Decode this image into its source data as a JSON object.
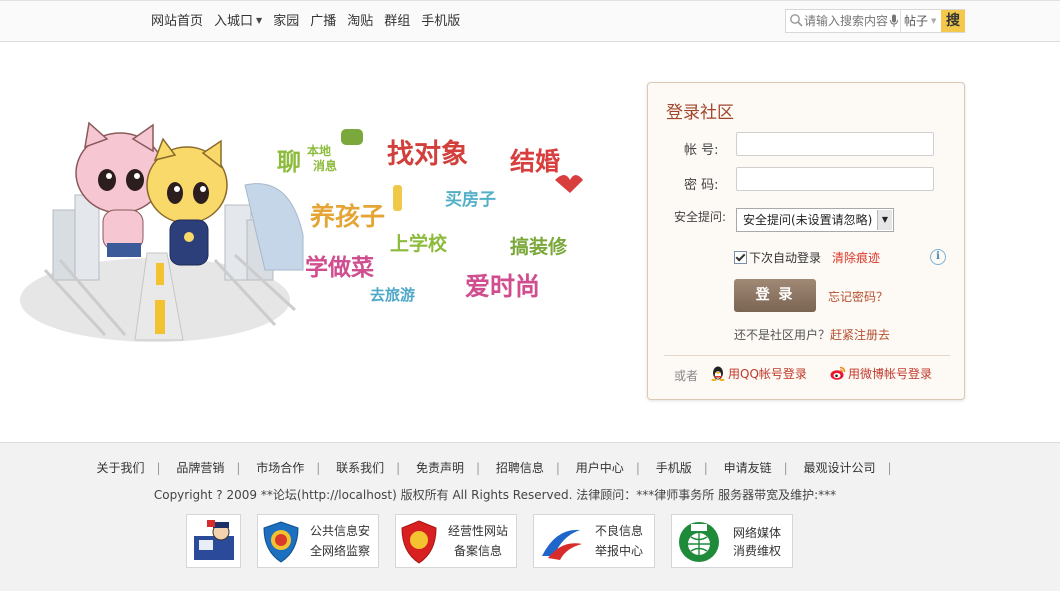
{
  "nav": {
    "items": [
      "网站首页",
      "入城口",
      "家园",
      "广播",
      "淘贴",
      "群组",
      "手机版"
    ]
  },
  "search": {
    "placeholder": "请输入搜索内容",
    "scope": "帖子",
    "button": "搜"
  },
  "illustration": {
    "words": [
      "聊",
      "本地",
      "消息",
      "找对象",
      "结婚",
      "养孩子",
      "买房子",
      "学做菜",
      "上学校",
      "搞装修",
      "去旅游",
      "爱时尚"
    ]
  },
  "login": {
    "title": "登录社区",
    "account_label": "帐   号:",
    "password_label": "密   码:",
    "question_label": "安全提问:",
    "question_value": "安全提问(未设置请忽略)",
    "remember": "下次自动登录",
    "clear": "清除痕迹",
    "submit": "登 录",
    "forgot": "忘记密码？",
    "not_member": "还不是社区用户？",
    "register": "赶紧注册去",
    "or": "或者",
    "qq": "用QQ帐号登录",
    "weibo": "用微博帐号登录"
  },
  "footer": {
    "links": [
      "关于我们",
      "品牌营销",
      "市场合作",
      "联系我们",
      "免责声明",
      "招聘信息",
      "用户中心",
      "手机版",
      "申请友链",
      "最观设计公司"
    ],
    "copyright": "Copyright ? 2009 **论坛(http://localhost) 版权所有 All Rights Reserved. 法律顾问：***律师事务所 服务器带宽及维护:***",
    "badges": {
      "b2": [
        "公共信息安",
        "全网络监察"
      ],
      "b3": [
        "经营性网站",
        "备案信息"
      ],
      "b4": [
        "不良信息",
        "举报中心"
      ],
      "b5": [
        "网络媒体",
        "消费维权"
      ]
    }
  }
}
